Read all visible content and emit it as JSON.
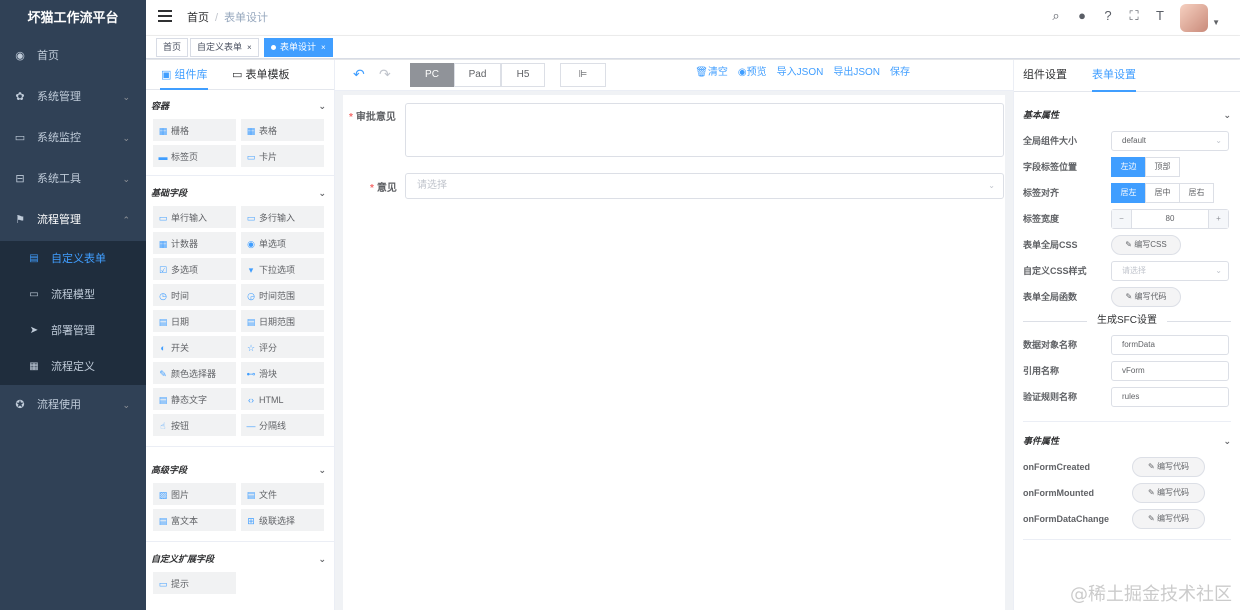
{
  "app": {
    "title": "坏猫工作流平台"
  },
  "menu": {
    "items": [
      {
        "label": "首页",
        "icon": "dashboard-icon"
      },
      {
        "label": "系统管理",
        "icon": "gear-icon"
      },
      {
        "label": "系统监控",
        "icon": "monitor-icon"
      },
      {
        "label": "系统工具",
        "icon": "toolbox-icon"
      },
      {
        "label": "流程管理",
        "icon": "flow-icon"
      }
    ],
    "sub": [
      {
        "label": "自定义表单",
        "active": true
      },
      {
        "label": "流程模型"
      },
      {
        "label": "部署管理"
      },
      {
        "label": "流程定义"
      }
    ],
    "last": {
      "label": "流程使用"
    }
  },
  "header": {
    "crumb_home": "首页",
    "crumb_sep": "/",
    "crumb_current": "表单设计"
  },
  "tags": [
    {
      "label": "首页"
    },
    {
      "label": "自定义表单",
      "close": "×"
    },
    {
      "label": "表单设计",
      "close": "×",
      "active": true
    }
  ],
  "left": {
    "tab1": "组件库",
    "tab2": "表单模板",
    "groups": [
      {
        "title": "容器",
        "items": [
          "栅格",
          "表格",
          "标签页",
          "卡片"
        ]
      },
      {
        "title": "基础字段",
        "items": [
          "单行输入",
          "多行输入",
          "计数器",
          "单选项",
          "多选项",
          "下拉选项",
          "时间",
          "时间范围",
          "日期",
          "日期范围",
          "开关",
          "评分",
          "颜色选择器",
          "滑块",
          "静态文字",
          "HTML",
          "按钮",
          "分隔线"
        ]
      },
      {
        "title": "高级字段",
        "items": [
          "图片",
          "文件",
          "富文本",
          "级联选择"
        ]
      },
      {
        "title": "自定义扩展字段",
        "items": [
          "提示"
        ]
      }
    ]
  },
  "toolbar": {
    "devices": [
      "PC",
      "Pad",
      "H5"
    ],
    "actions": [
      "清空",
      "预览",
      "导入JSON",
      "导出JSON",
      "保存"
    ]
  },
  "form": {
    "f1_label": "审批意见",
    "f2_label": "意见",
    "required_mark": "*",
    "f2_placeholder": "请选择"
  },
  "right": {
    "tab1": "组件设置",
    "tab2": "表单设置",
    "basic_title": "基本属性",
    "size_label": "全局组件大小",
    "size_value": "default",
    "label_pos_label": "字段标签位置",
    "label_pos_opts": [
      "左边",
      "顶部"
    ],
    "align_label": "标签对齐",
    "align_opts": [
      "居左",
      "居中",
      "居右"
    ],
    "width_label": "标签宽度",
    "width_value": "80",
    "minus": "−",
    "plus": "+",
    "css_label": "表单全局CSS",
    "css_btn": "编写CSS",
    "custom_css_label": "自定义CSS样式",
    "custom_css_ph": "请选择",
    "func_label": "表单全局函数",
    "func_btn": "编写代码",
    "sfc_title": "生成SFC设置",
    "data_obj_label": "数据对象名称",
    "data_obj_value": "formData",
    "ref_label": "引用名称",
    "ref_value": "vForm",
    "rules_label": "验证规则名称",
    "rules_value": "rules",
    "event_title": "事件属性",
    "events": [
      {
        "label": "onFormCreated",
        "btn": "编写代码"
      },
      {
        "label": "onFormMounted",
        "btn": "编写代码"
      },
      {
        "label": "onFormDataChange",
        "btn": "编写代码"
      }
    ]
  },
  "watermark": "@稀土掘金技术社区"
}
